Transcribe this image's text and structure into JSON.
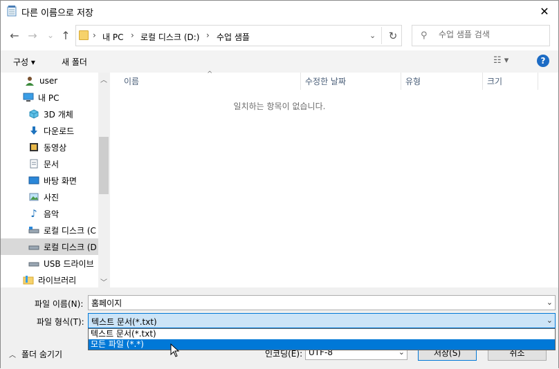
{
  "window": {
    "title": "다른 이름으로 저장",
    "close_symbol": "✕"
  },
  "nav": {
    "back_icon": "←",
    "forward_icon": "→",
    "recent_icon": "⌄",
    "up_icon": "↑",
    "breadcrumbs": [
      "내 PC",
      "로컬 디스크 (D:)",
      "수업 샘플"
    ],
    "crumb_separator": "›",
    "address_dropdown_icon": "⌄",
    "refresh_icon": "↻",
    "search_placeholder": "수업 샘플 검색"
  },
  "toolbar": {
    "organize_label": "구성 ▾",
    "new_folder_label": "새 폴더",
    "view_icon": "☷ ▾",
    "help_label": "?"
  },
  "sidebar": {
    "items": [
      {
        "label": "user",
        "icon": "user-icon",
        "glyph": "👤"
      },
      {
        "label": "내 PC",
        "icon": "computer-icon",
        "glyph": "🖳"
      },
      {
        "label": "3D 개체",
        "icon": "cube-icon",
        "glyph": "⬡"
      },
      {
        "label": "다운로드",
        "icon": "download-icon",
        "glyph": "⬇"
      },
      {
        "label": "동영상",
        "icon": "video-icon",
        "glyph": "🎞"
      },
      {
        "label": "문서",
        "icon": "document-icon",
        "glyph": "🗎"
      },
      {
        "label": "바탕 화면",
        "icon": "desktop-icon",
        "glyph": "▭"
      },
      {
        "label": "사진",
        "icon": "picture-icon",
        "glyph": "🖼"
      },
      {
        "label": "음악",
        "icon": "music-icon",
        "glyph": "♪"
      },
      {
        "label": "로컬 디스크 (C",
        "icon": "drive-icon",
        "glyph": "▬"
      },
      {
        "label": "로컬 디스크 (D",
        "icon": "drive-icon",
        "glyph": "▬",
        "selected": true
      },
      {
        "label": "USB 드라이브",
        "icon": "usb-drive-icon",
        "glyph": "▬"
      },
      {
        "label": "라이브러리",
        "icon": "library-icon",
        "glyph": "▤"
      }
    ]
  },
  "filelist": {
    "columns": [
      "이름",
      "수정한 날짜",
      "유형",
      "크기"
    ],
    "empty_message": "일치하는 항목이 없습니다."
  },
  "form": {
    "filename_label": "파일 이름(N):",
    "filename_value": "홈페이지",
    "filetype_label": "파일 형식(T):",
    "filetype_value": "텍스트 문서(*.txt)",
    "filetype_options": [
      "텍스트 문서(*.txt)",
      "모든 파일 (*.*)"
    ],
    "highlighted_option_index": 1,
    "hide_folders_label": "폴더 숨기기",
    "encoding_label": "인코딩(E):",
    "encoding_value": "UTF-8",
    "save_label": "저장(S)",
    "cancel_label": "취소"
  },
  "colors": {
    "accent": "#0078d7",
    "selected_field": "#cce4f7",
    "help": "#1c6bc4",
    "column_header_text": "#4c607a"
  }
}
